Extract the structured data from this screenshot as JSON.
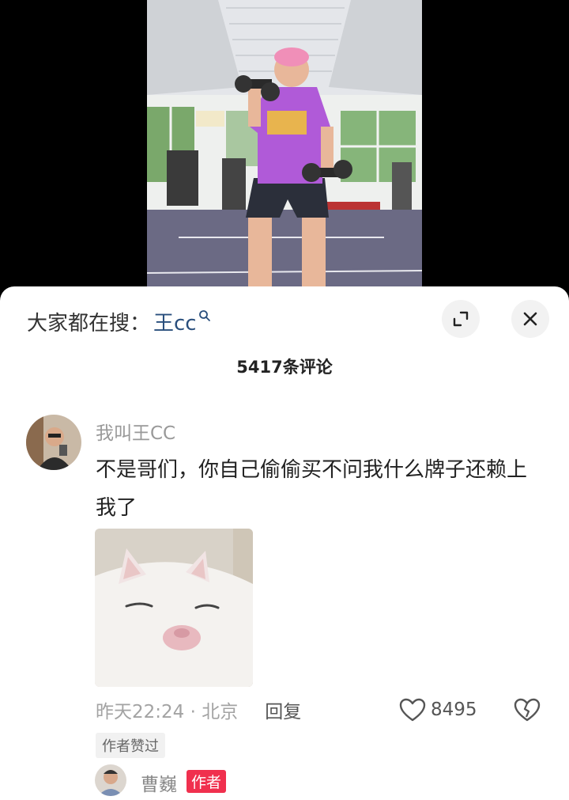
{
  "video": {
    "description_icon": "gym-video-frame"
  },
  "sheet": {
    "search_prefix": "大家都在搜：",
    "search_keyword": "王cc",
    "comment_count": "5417条评论"
  },
  "comment": {
    "username": "我叫王CC",
    "text": "不是哥们，你自己偷偷买不问我什么牌子还赖上我了",
    "time_location": "昨天22:24 · 北京",
    "reply_label": "回复",
    "like_count": "8495",
    "author_liked": "作者赞过"
  },
  "reply": {
    "name": "曹巍",
    "tag": "作者"
  },
  "colors": {
    "accent_red": "#f0304e",
    "keyword_blue": "#2a4f7d"
  }
}
